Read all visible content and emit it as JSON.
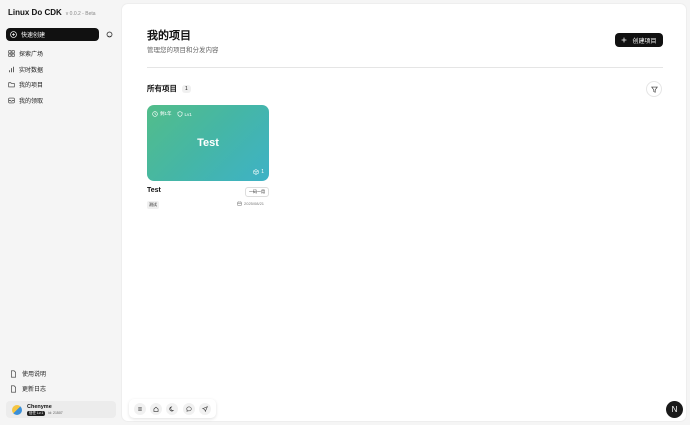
{
  "app": {
    "name": "Linux Do CDK",
    "version": "v 0.0.2 - Beta"
  },
  "sidebar": {
    "quick_create_label": "快速创建",
    "items": [
      {
        "label": "探索广场",
        "icon": "grid-icon"
      },
      {
        "label": "实时数据",
        "icon": "bar-chart-icon"
      },
      {
        "label": "我的项目",
        "icon": "folder-icon"
      },
      {
        "label": "我的领取",
        "icon": "inbox-icon"
      }
    ],
    "footer": [
      {
        "label": "使用说明",
        "icon": "document-icon"
      },
      {
        "label": "更新日志",
        "icon": "document-icon"
      }
    ],
    "user": {
      "name": "Chenyme",
      "badge": "信任 Lv.1",
      "id": "id: 21507"
    }
  },
  "main": {
    "title": "我的项目",
    "subtitle": "管理您的项目和分发内容",
    "create_label": "创建项目",
    "section_title": "所有项目",
    "section_count": "1"
  },
  "projects": [
    {
      "card_title": "Test",
      "time_left": "剩1年",
      "level": "Lv1",
      "count": "1",
      "name": "Test",
      "distribution": "一码一用",
      "tag": "测试",
      "date": "2025/08/21"
    }
  ],
  "colors": {
    "accent": "#111111",
    "card_gradient_start": "#52bd8a",
    "card_gradient_end": "#3eb2c6"
  }
}
